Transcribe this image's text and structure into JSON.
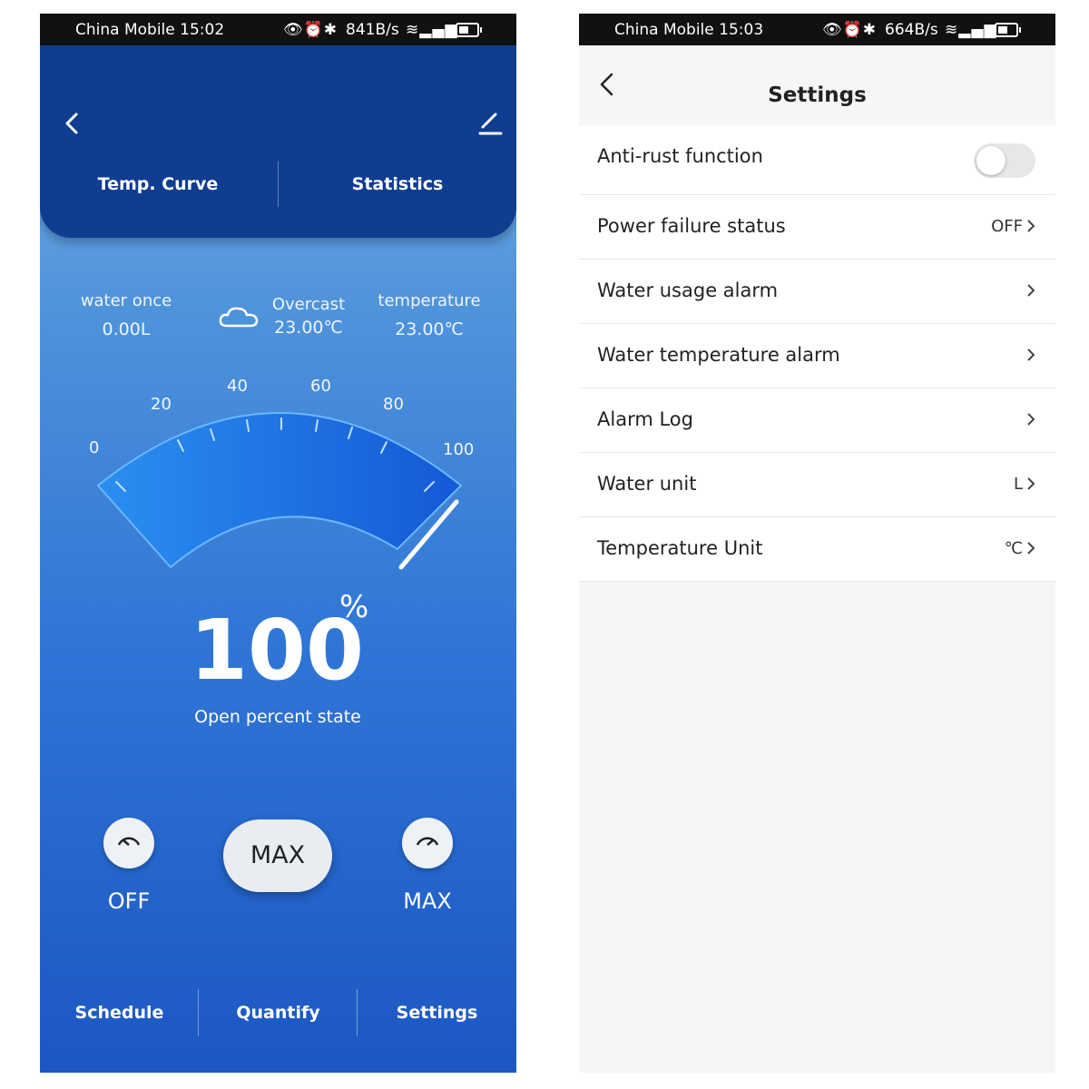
{
  "left_screen": {
    "status_bar": {
      "carrier": "China Mobile",
      "time": "15:02",
      "speed": "841B/s"
    },
    "tabs": [
      {
        "label": "Temp. Curve"
      },
      {
        "label": "Statistics"
      }
    ],
    "water_once": {
      "label": "water once",
      "value": "0.00L"
    },
    "weather": {
      "condition": "Overcast",
      "value": "23.00℃"
    },
    "temperature": {
      "label": "temperature",
      "value": "23.00℃"
    },
    "gauge": {
      "ticks": [
        "0",
        "20",
        "40",
        "60",
        "80",
        "100"
      ],
      "level_percent": 100
    },
    "open_percent": {
      "value": "100",
      "unit": "%",
      "label": "Open percent state"
    },
    "controls": {
      "off_label": "OFF",
      "center_label": "MAX",
      "max_label": "MAX"
    },
    "bottom_nav": [
      {
        "label": "Schedule"
      },
      {
        "label": "Quantify"
      },
      {
        "label": "Settings"
      }
    ],
    "colors": {
      "header": "#103d90",
      "gradient_top": "#7ab2e2",
      "gradient_bottom": "#1c57c2"
    }
  },
  "right_screen": {
    "status_bar": {
      "carrier": "China Mobile",
      "time": "15:03",
      "speed": "664B/s"
    },
    "title": "Settings",
    "rows": [
      {
        "label": "Anti-rust function",
        "type": "toggle",
        "on": false
      },
      {
        "label": "Power failure status",
        "value": "OFF"
      },
      {
        "label": "Water usage alarm",
        "value": ""
      },
      {
        "label": "Water temperature alarm",
        "value": ""
      },
      {
        "label": "Alarm Log",
        "value": ""
      },
      {
        "label": "Water unit",
        "value": "L"
      },
      {
        "label": "Temperature Unit",
        "value": "℃"
      }
    ]
  }
}
